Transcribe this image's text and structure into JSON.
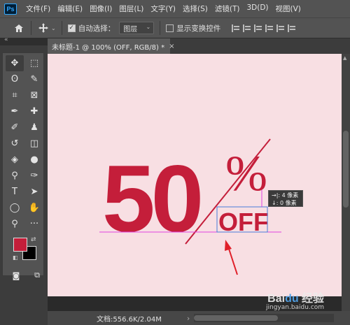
{
  "app": {
    "logo_text": "Ps"
  },
  "menu": [
    "文件(F)",
    "编辑(E)",
    "图像(I)",
    "图层(L)",
    "文字(Y)",
    "选择(S)",
    "滤镜(T)",
    "3D(D)",
    "视图(V)"
  ],
  "options": {
    "auto_select_label": "自动选择：",
    "auto_select_checked": true,
    "auto_select_target": "图层",
    "transform_controls_label": "显示变换控件",
    "transform_controls_checked": false
  },
  "toolbar": {
    "collapse_label": "«",
    "tools": [
      {
        "name": "move-tool",
        "glyph": "✥",
        "active": true
      },
      {
        "name": "marquee-tool",
        "glyph": "⬚",
        "active": false
      },
      {
        "name": "lasso-tool",
        "glyph": "ʘ",
        "active": false
      },
      {
        "name": "quick-select-tool",
        "glyph": "✎",
        "active": false
      },
      {
        "name": "crop-tool",
        "glyph": "⌗",
        "active": false
      },
      {
        "name": "frame-tool",
        "glyph": "⊠",
        "active": false
      },
      {
        "name": "eyedropper-tool",
        "glyph": "✒",
        "active": false
      },
      {
        "name": "healing-tool",
        "glyph": "✚",
        "active": false
      },
      {
        "name": "brush-tool",
        "glyph": "✐",
        "active": false
      },
      {
        "name": "stamp-tool",
        "glyph": "♟",
        "active": false
      },
      {
        "name": "history-brush-tool",
        "glyph": "↺",
        "active": false
      },
      {
        "name": "eraser-tool",
        "glyph": "◫",
        "active": false
      },
      {
        "name": "paint-bucket-tool",
        "glyph": "◈",
        "active": false
      },
      {
        "name": "blur-tool",
        "glyph": "●",
        "active": false
      },
      {
        "name": "dodge-tool",
        "glyph": "⚲",
        "active": false
      },
      {
        "name": "pen-tool",
        "glyph": "✑",
        "active": false
      },
      {
        "name": "type-tool",
        "glyph": "T",
        "active": false
      },
      {
        "name": "path-select-tool",
        "glyph": "➤",
        "active": false
      },
      {
        "name": "ellipse-tool",
        "glyph": "◯",
        "active": false
      },
      {
        "name": "hand-tool",
        "glyph": "✋",
        "active": false
      },
      {
        "name": "zoom-tool",
        "glyph": "⚲",
        "active": false
      },
      {
        "name": "more-tools",
        "glyph": "···",
        "active": false
      }
    ],
    "foreground_color": "#c41e3a",
    "background_color": "#000000"
  },
  "document": {
    "tab_title": "未标题-1 @ 100% (OFF, RGB/8) *",
    "close_glyph": "×"
  },
  "canvas": {
    "bg_color": "#f8dfe3",
    "accent_color": "#c41e3a",
    "big_number": "50",
    "percent": "%",
    "off_text": "OFF",
    "tooltip_line1": "→|: 4 像素",
    "tooltip_line2": "↓: 0 像素"
  },
  "status": {
    "doc_info": "文档:556.6K/2.04M"
  },
  "watermark": {
    "logo_left": "Bai",
    "logo_mid": "du",
    "logo_right": " 经验",
    "sub": "jingyan.baidu.com"
  }
}
